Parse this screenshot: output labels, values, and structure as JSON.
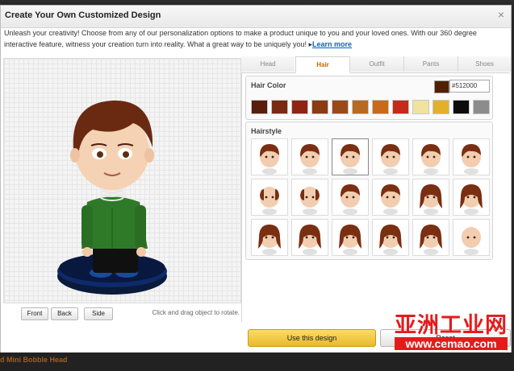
{
  "dialog": {
    "title": "Create Your Own Customized Design",
    "intro_text": "Unleash your creativity! Choose from any of our personalization options to make a product unique to you and your loved ones. With our 360 degree interactive feature, witness your creation turn into reality. What a great way to be uniquely you! ▸",
    "learn_more": "Learn more"
  },
  "preview": {
    "view_buttons": [
      "Front",
      "Back",
      "Side"
    ],
    "hint": "Click and drag object to rotate."
  },
  "tabs": [
    "Head",
    "Hair",
    "Outfit",
    "Pants",
    "Shoes"
  ],
  "active_tab": "Hair",
  "hair_color": {
    "label": "Hair Color",
    "current_hex": "#512000",
    "swatches": [
      "#5a1c0c",
      "#7a2a10",
      "#8f2414",
      "#8a3c12",
      "#9a4a1a",
      "#b86a20",
      "#c86a18",
      "#c52a1a",
      "#f0e2a0",
      "#e2b02a",
      "#0c0c0c",
      "#8c8c8c"
    ]
  },
  "hairstyle": {
    "label": "Hairstyle",
    "selected_index": 2,
    "styles": [
      "short-side-part",
      "short-classic",
      "short-swept",
      "short-fringe",
      "short-crop",
      "short-spiky",
      "receding",
      "bald-top",
      "medium-wavy",
      "curly-top",
      "bob",
      "long-straight",
      "long-wavy",
      "long-layered",
      "long-shag",
      "long-flowing",
      "long-volume",
      "bald"
    ]
  },
  "actions": {
    "use_design": "Use this design",
    "reset": "Reset"
  },
  "footer": {
    "product_text": "d Mini Bobble Head"
  },
  "watermark": {
    "cn": "亚洲工业网",
    "url": "www.cemao.com"
  }
}
